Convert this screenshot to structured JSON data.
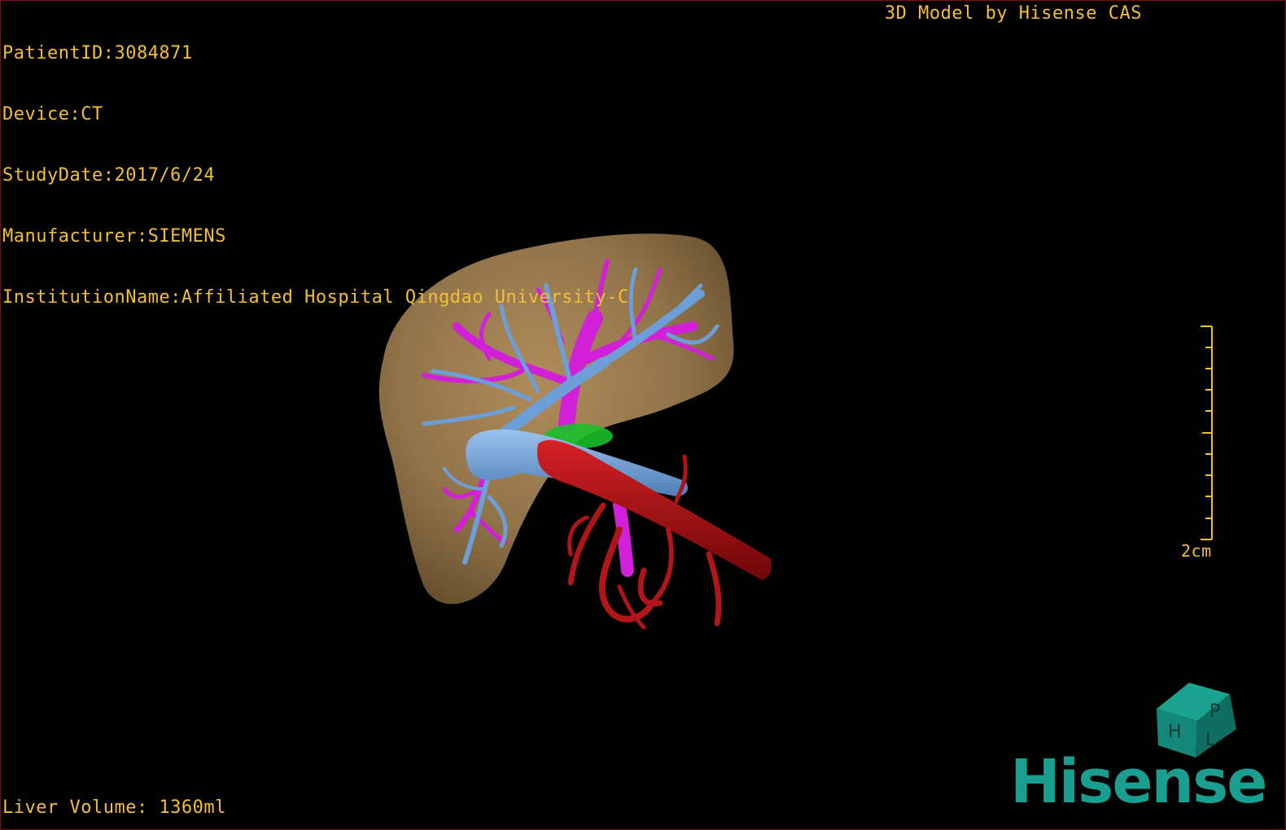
{
  "patient_info": {
    "patient_id": "PatientID:3084871",
    "device": "Device:CT",
    "study_date": "StudyDate:2017/6/24",
    "manufacturer": "Manufacturer:SIEMENS",
    "institution": "InstitutionName:Affiliated Hospital Qingdao University-C"
  },
  "brand_title": "3D Model by Hisense CAS",
  "scale_bar": {
    "label": "2cm"
  },
  "footer": {
    "liver_volume": "Liver Volume: 1360ml"
  },
  "logo": {
    "text": "Hisense"
  },
  "orientation_cube": {
    "faces": [
      "P",
      "H",
      "L"
    ]
  },
  "colors": {
    "overlay_text": "#f2bf3a",
    "liver": "#9a7a4e",
    "hepatic_vein": "#6c9fd8",
    "portal_vein": "#d21fd8",
    "artery": "#a80f12",
    "gallbladder": "#1bbf2a",
    "logo": "#1a9e8f"
  },
  "icons": [
    "orientation-cube-icon",
    "hisense-logo"
  ]
}
